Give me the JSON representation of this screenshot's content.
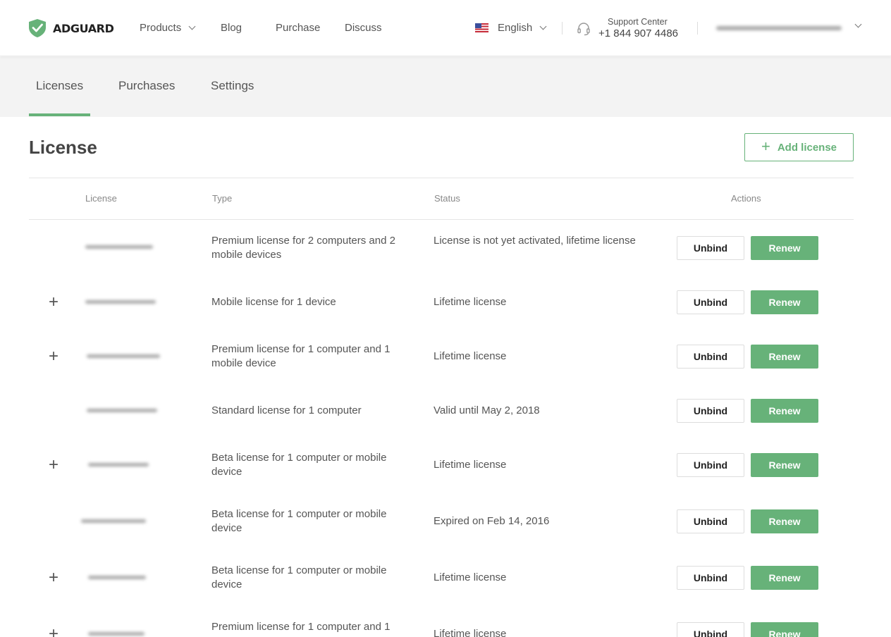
{
  "header": {
    "logo_text": "ADGUARD",
    "nav": [
      {
        "label": "Products",
        "has_dropdown": true
      },
      {
        "label": "Blog"
      },
      {
        "label": "Purchase"
      },
      {
        "label": "Discuss"
      }
    ],
    "language": "English",
    "support_label": "Support Center",
    "support_phone": "+1 844 907 4486"
  },
  "tabs": [
    {
      "label": "Licenses",
      "active": true
    },
    {
      "label": "Purchases"
    },
    {
      "label": "Settings"
    }
  ],
  "page": {
    "title": "License",
    "add_button": "Add license"
  },
  "table": {
    "columns": [
      "License",
      "Type",
      "Status",
      "Actions"
    ],
    "unbind_label": "Unbind",
    "renew_label": "Renew",
    "rows": [
      {
        "type": "Premium license for 2 computers and 2 mobile devices",
        "status": "License is not yet activated, lifetime license",
        "expandable": false
      },
      {
        "type": "Mobile license for 1 device",
        "status": "Lifetime license",
        "expandable": true
      },
      {
        "type": "Premium license for 1 computer and 1 mobile device",
        "status": "Lifetime license",
        "expandable": true
      },
      {
        "type": "Standard license for 1 computer",
        "status": "Valid until May 2, 2018",
        "expandable": false
      },
      {
        "type": "Beta license for 1 computer or mobile device",
        "status": "Lifetime license",
        "expandable": true
      },
      {
        "type": "Beta license for 1 computer or mobile device",
        "status": "Expired on Feb 14, 2016",
        "expandable": false
      },
      {
        "type": "Beta license for 1 computer or mobile device",
        "status": "Lifetime license",
        "expandable": true
      },
      {
        "type": "Premium license for 1 computer and 1",
        "status": "Lifetime license",
        "expandable": true
      }
    ]
  },
  "colors": {
    "accent": "#67b279",
    "tab_bg": "#f3f3f3",
    "text": "#555555"
  },
  "icons": [
    "adguard-shield-icon",
    "chevron-down-icon",
    "us-flag-icon",
    "headset-icon",
    "plus-icon",
    "expand-plus-icon"
  ]
}
